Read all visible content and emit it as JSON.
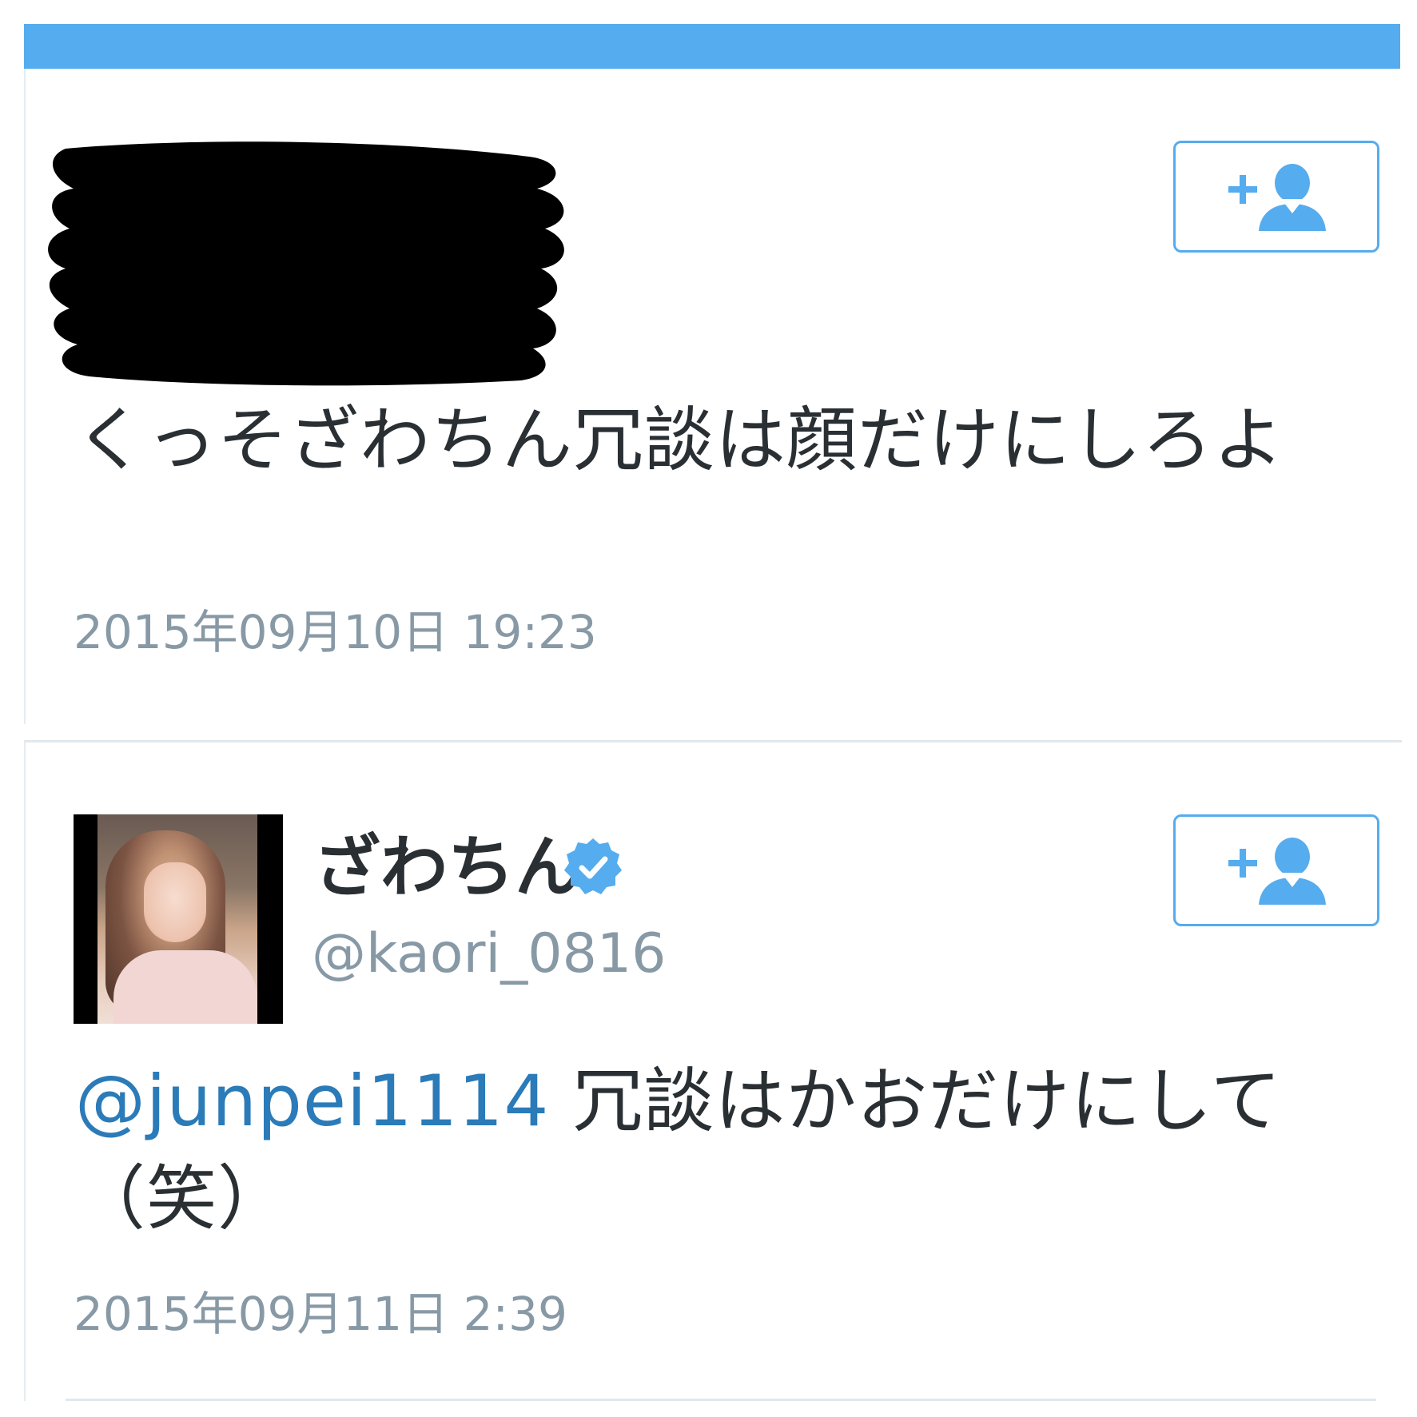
{
  "colors": {
    "accent": "#55acee",
    "text": "#292f33",
    "muted": "#8899a6",
    "mention": "#2b7bb9"
  },
  "tweets": [
    {
      "author_redacted": true,
      "text": "くっそざわちん冗談は顔だけにしろよ",
      "timestamp": "2015年09月10日 19:23",
      "follow_icon": "add-user-icon"
    },
    {
      "display_name": "ざわちん",
      "verified": true,
      "handle": "@kaori_0816",
      "mention": "@junpei1114",
      "text": " 冗談はかおだけにして（笑）",
      "timestamp": "2015年09月11日 2:39",
      "follow_icon": "add-user-icon"
    }
  ]
}
